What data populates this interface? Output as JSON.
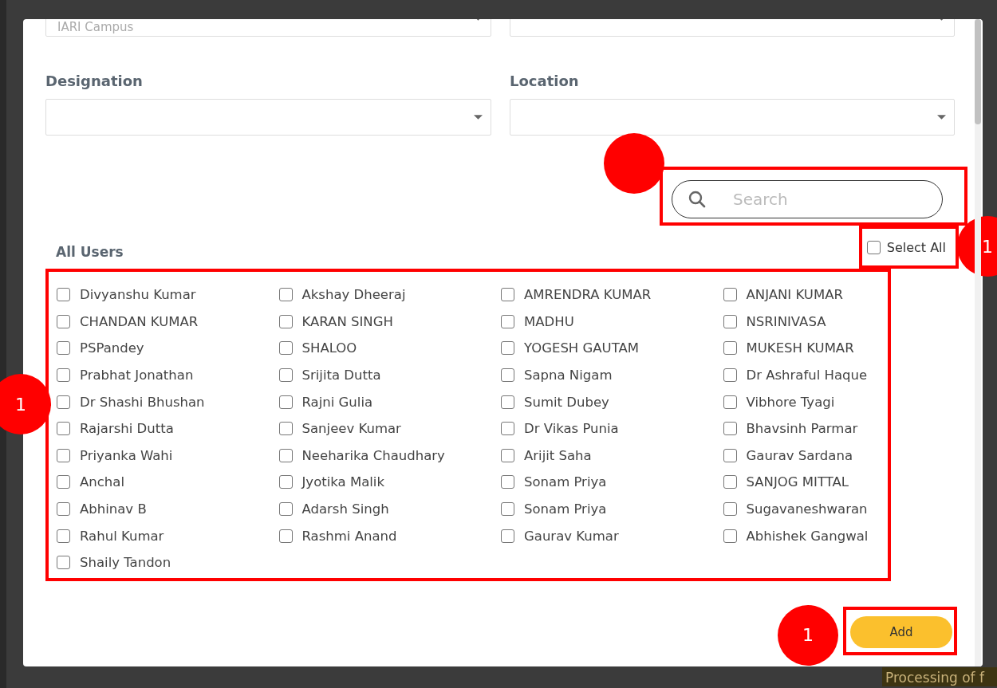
{
  "background": {
    "fragment": "Processing of f"
  },
  "filters": [
    {
      "value": "IARI Campus",
      "partial": true
    },
    {
      "partial": true
    },
    {
      "label": "Designation",
      "partial": false
    },
    {
      "label": "Location",
      "partial": false
    }
  ],
  "search": {
    "placeholder": "Search",
    "highlighted": true,
    "callout": {
      "kind": "dot"
    }
  },
  "users_heading": "All Users",
  "select_all": {
    "label": "Select All",
    "checked": false,
    "highlighted": true,
    "callout": {
      "kind": "numbered",
      "label": "1"
    }
  },
  "users_highlighted": true,
  "users_callout": {
    "kind": "numbered",
    "label": "1"
  },
  "users": [
    {
      "name": "Divyanshu Kumar",
      "checked": false
    },
    {
      "name": "Akshay Dheeraj",
      "checked": false
    },
    {
      "name": "AMRENDRA KUMAR",
      "checked": false
    },
    {
      "name": "ANJANI KUMAR",
      "checked": false
    },
    {
      "name": "CHANDAN KUMAR",
      "checked": false
    },
    {
      "name": "KARAN SINGH",
      "checked": false
    },
    {
      "name": "MADHU",
      "checked": false
    },
    {
      "name": "NSRINIVASA",
      "checked": false
    },
    {
      "name": "PSPandey",
      "checked": false
    },
    {
      "name": "SHALOO",
      "checked": false
    },
    {
      "name": "YOGESH GAUTAM",
      "checked": false
    },
    {
      "name": "MUKESH KUMAR",
      "checked": false
    },
    {
      "name": "Prabhat Jonathan",
      "checked": false
    },
    {
      "name": "Srijita Dutta",
      "checked": false
    },
    {
      "name": "Sapna Nigam",
      "checked": false
    },
    {
      "name": "Dr Ashraful Haque",
      "checked": false
    },
    {
      "name": "Dr Shashi Bhushan",
      "checked": false
    },
    {
      "name": "Rajni Gulia",
      "checked": false
    },
    {
      "name": "Sumit Dubey",
      "checked": false
    },
    {
      "name": "Vibhore Tyagi",
      "checked": false
    },
    {
      "name": "Rajarshi Dutta",
      "checked": false
    },
    {
      "name": "Sanjeev Kumar",
      "checked": false
    },
    {
      "name": "Dr Vikas Punia",
      "checked": false
    },
    {
      "name": "Bhavsinh Parmar",
      "checked": false
    },
    {
      "name": "Priyanka Wahi",
      "checked": false
    },
    {
      "name": "Neeharika Chaudhary",
      "checked": false
    },
    {
      "name": "Arijit Saha",
      "checked": false
    },
    {
      "name": "Gaurav Sardana",
      "checked": false
    },
    {
      "name": "Anchal",
      "checked": false
    },
    {
      "name": "Jyotika Malik",
      "checked": false
    },
    {
      "name": "Sonam Priya",
      "checked": false
    },
    {
      "name": "SANJOG MITTAL",
      "checked": false
    },
    {
      "name": "Abhinav B",
      "checked": false
    },
    {
      "name": "Adarsh Singh",
      "checked": false
    },
    {
      "name": "Sonam Priya",
      "checked": false
    },
    {
      "name": "Sugavaneshwaran",
      "checked": false
    },
    {
      "name": "Rahul Kumar",
      "checked": false
    },
    {
      "name": "Rashmi Anand",
      "checked": false
    },
    {
      "name": "Gaurav Kumar",
      "checked": false
    },
    {
      "name": "Abhishek Gangwal",
      "checked": false
    },
    {
      "name": "Shaily Tandon",
      "checked": false
    }
  ],
  "add_button": {
    "label": "Add",
    "highlighted": true,
    "callout": {
      "kind": "numbered",
      "label": "1"
    }
  }
}
